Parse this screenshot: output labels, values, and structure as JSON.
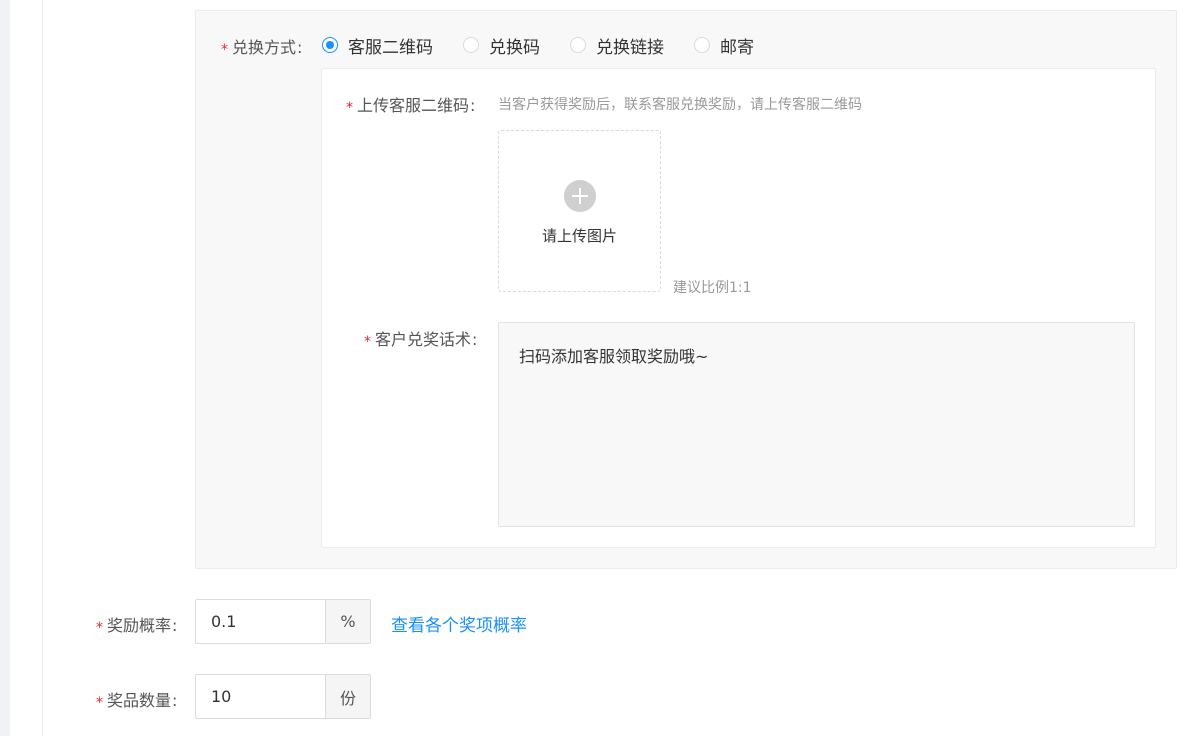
{
  "exchange": {
    "label": "兑换方式",
    "options": [
      {
        "label": "客服二维码",
        "checked": true
      },
      {
        "label": "兑换码",
        "checked": false
      },
      {
        "label": "兑换链接",
        "checked": false
      },
      {
        "label": "邮寄",
        "checked": false
      }
    ]
  },
  "qrcode": {
    "label": "上传客服二维码",
    "hint": "当客户获得奖励后，联系客服兑换奖励，请上传客服二维码",
    "upload_text": "请上传图片",
    "ratio_hint": "建议比例1:1"
  },
  "script": {
    "label": "客户兑奖话术",
    "value": "扫码添加客服领取奖励哦~"
  },
  "probability": {
    "label": "奖励概率",
    "value": "0.1",
    "suffix": "%",
    "link": "查看各个奖项概率"
  },
  "quantity": {
    "label": "奖品数量",
    "value": "10",
    "suffix": "份"
  },
  "colors": {
    "primary": "#1890ff",
    "required": "#f5222d"
  }
}
